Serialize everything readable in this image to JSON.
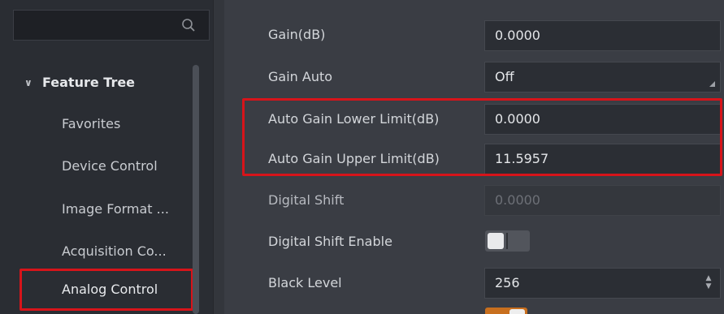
{
  "search": {
    "icon": "search-icon"
  },
  "feature_tree": {
    "header": "Feature Tree",
    "header_icon": "chevron-down-icon",
    "items": [
      {
        "label": "Favorites"
      },
      {
        "label": "Device Control"
      },
      {
        "label": "Image Format ..."
      },
      {
        "label": "Acquisition Co..."
      },
      {
        "label": "Analog Control",
        "selected": true
      }
    ]
  },
  "properties": [
    {
      "label": "Gain(dB)",
      "value": "0.0000",
      "type": "number"
    },
    {
      "label": "Gain Auto",
      "value": "Off",
      "type": "dropdown"
    },
    {
      "label": "Auto Gain Lower Limit(dB)",
      "value": "0.0000",
      "type": "number",
      "highlighted": true
    },
    {
      "label": "Auto Gain Upper Limit(dB)",
      "value": "11.5957",
      "type": "number",
      "highlighted": true
    },
    {
      "label": "Digital Shift",
      "value": "0.0000",
      "type": "number",
      "disabled": true
    },
    {
      "label": "Digital Shift Enable",
      "type": "toggle",
      "on": false
    },
    {
      "label": "Black Level",
      "value": "256",
      "type": "spinbox"
    }
  ],
  "colors": {
    "highlight_border": "#d7141a",
    "panel_bg": "#2a2d33",
    "grid_bg": "#3a3d44",
    "toggle_on": "#c86f1e"
  }
}
